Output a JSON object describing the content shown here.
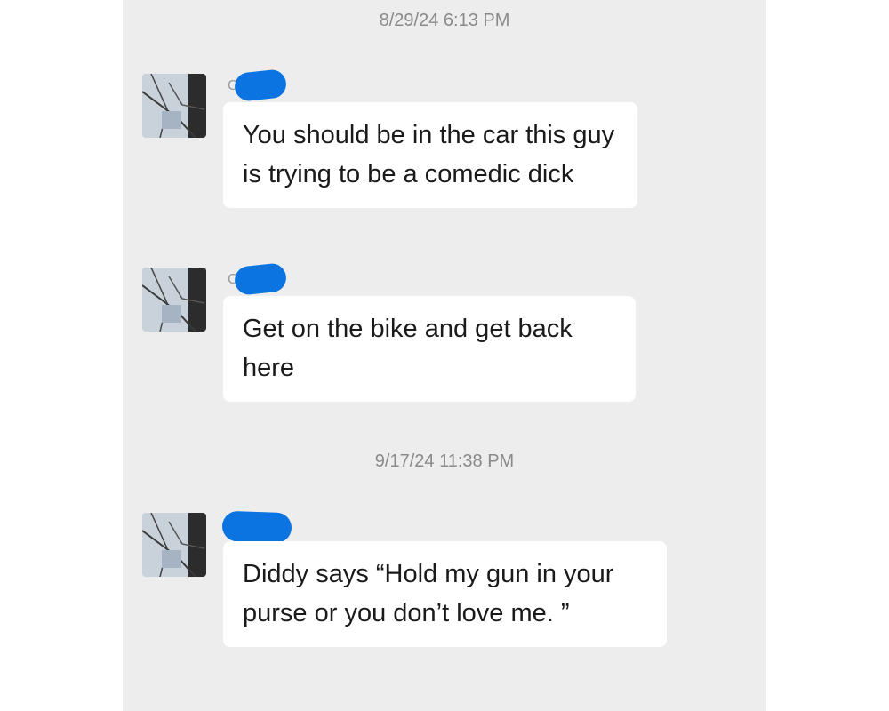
{
  "conversation": {
    "groups": [
      {
        "timestamp": "8/29/24 6:13 PM",
        "messages": [
          {
            "sender_initial": "C",
            "text": "You should be in the car this guy is trying to be a comedic dick"
          },
          {
            "sender_initial": "C",
            "text": "Get on the bike and get back here"
          }
        ]
      },
      {
        "timestamp": "9/17/24 11:38 PM",
        "messages": [
          {
            "sender_initial": "",
            "text": "Diddy says “Hold my gun in your purse or you don’t love me. ”"
          }
        ]
      }
    ]
  },
  "colors": {
    "chat_background": "#ededed",
    "bubble": "#ffffff",
    "redaction": "#0b74e0",
    "timestamp_text": "#8a8a8a"
  },
  "icons": {
    "avatar": "profile-photo-icon"
  }
}
